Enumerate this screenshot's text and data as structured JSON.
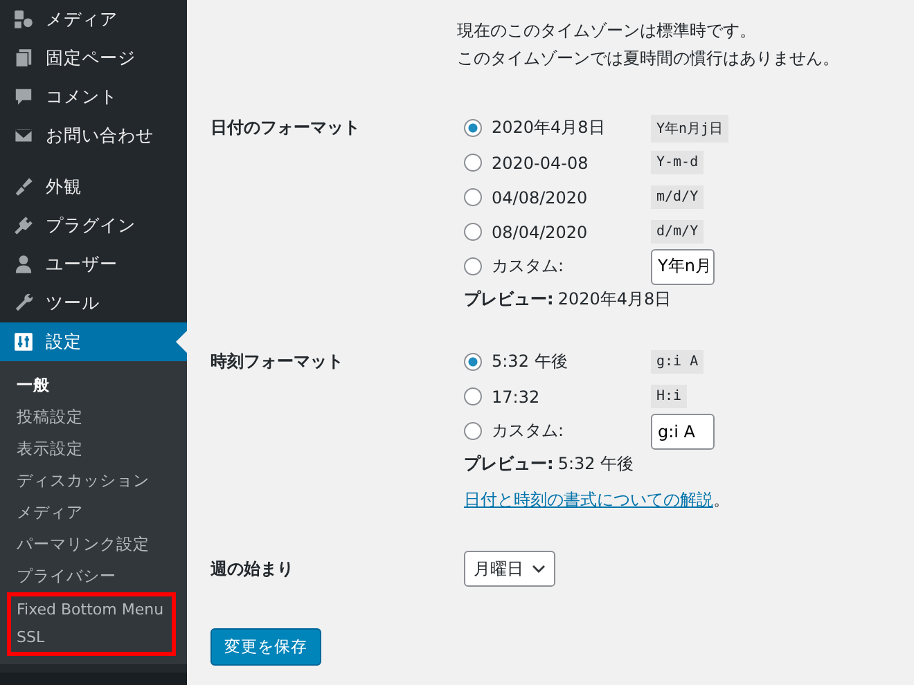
{
  "sidebar": {
    "items": [
      {
        "label": "メディア",
        "kind": "media",
        "selected": false
      },
      {
        "label": "固定ページ",
        "kind": "page",
        "selected": false
      },
      {
        "label": "コメント",
        "kind": "comment",
        "selected": false
      },
      {
        "label": "お問い合わせ",
        "kind": "mail",
        "selected": false
      },
      {
        "label": "外観",
        "kind": "appearance",
        "selected": false
      },
      {
        "label": "プラグイン",
        "kind": "plugin",
        "selected": false
      },
      {
        "label": "ユーザー",
        "kind": "user",
        "selected": false
      },
      {
        "label": "ツール",
        "kind": "tool",
        "selected": false
      },
      {
        "label": "設定",
        "kind": "settings",
        "selected": true
      }
    ],
    "submenu": [
      {
        "label": "一般",
        "selected": true
      },
      {
        "label": "投稿設定",
        "selected": false
      },
      {
        "label": "表示設定",
        "selected": false
      },
      {
        "label": "ディスカッション",
        "selected": false
      },
      {
        "label": "メディア",
        "selected": false
      },
      {
        "label": "パーマリンク設定",
        "selected": false
      },
      {
        "label": "プライバシー",
        "selected": false
      }
    ],
    "highlighted_items": [
      {
        "label": "Fixed Bottom Menu",
        "selected": false
      },
      {
        "label": "SSL",
        "selected": false
      }
    ]
  },
  "timezone_notes": [
    "現在のこのタイムゾーンは標準時です。",
    "このタイムゾーンでは夏時間の慣行はありません。"
  ],
  "date_format": {
    "label": "日付のフォーマット",
    "options": [
      {
        "label": "2020年4月8日",
        "code": "Y年n月j日",
        "selected": true
      },
      {
        "label": "2020-04-08",
        "code": "Y-m-d",
        "selected": false
      },
      {
        "label": "04/08/2020",
        "code": "m/d/Y",
        "selected": false
      },
      {
        "label": "08/04/2020",
        "code": "d/m/Y",
        "selected": false
      }
    ],
    "custom": {
      "label": "カスタム:",
      "value": "Y年n月",
      "selected": false
    },
    "preview_label": "プレビュー:",
    "preview": "2020年4月8日"
  },
  "time_format": {
    "label": "時刻フォーマット",
    "options": [
      {
        "label": "5:32 午後",
        "code": "g:i A",
        "selected": true
      },
      {
        "label": "17:32",
        "code": "H:i",
        "selected": false
      }
    ],
    "custom": {
      "label": "カスタム:",
      "value": "g:i A",
      "selected": false
    },
    "preview_label": "プレビュー:",
    "preview": "5:32 午後"
  },
  "doc_link": "日付と時刻の書式についての解説",
  "doc_link_suffix": "。",
  "week_start": {
    "label": "週の始まり",
    "value": "月曜日"
  },
  "save_button": "変更を保存"
}
